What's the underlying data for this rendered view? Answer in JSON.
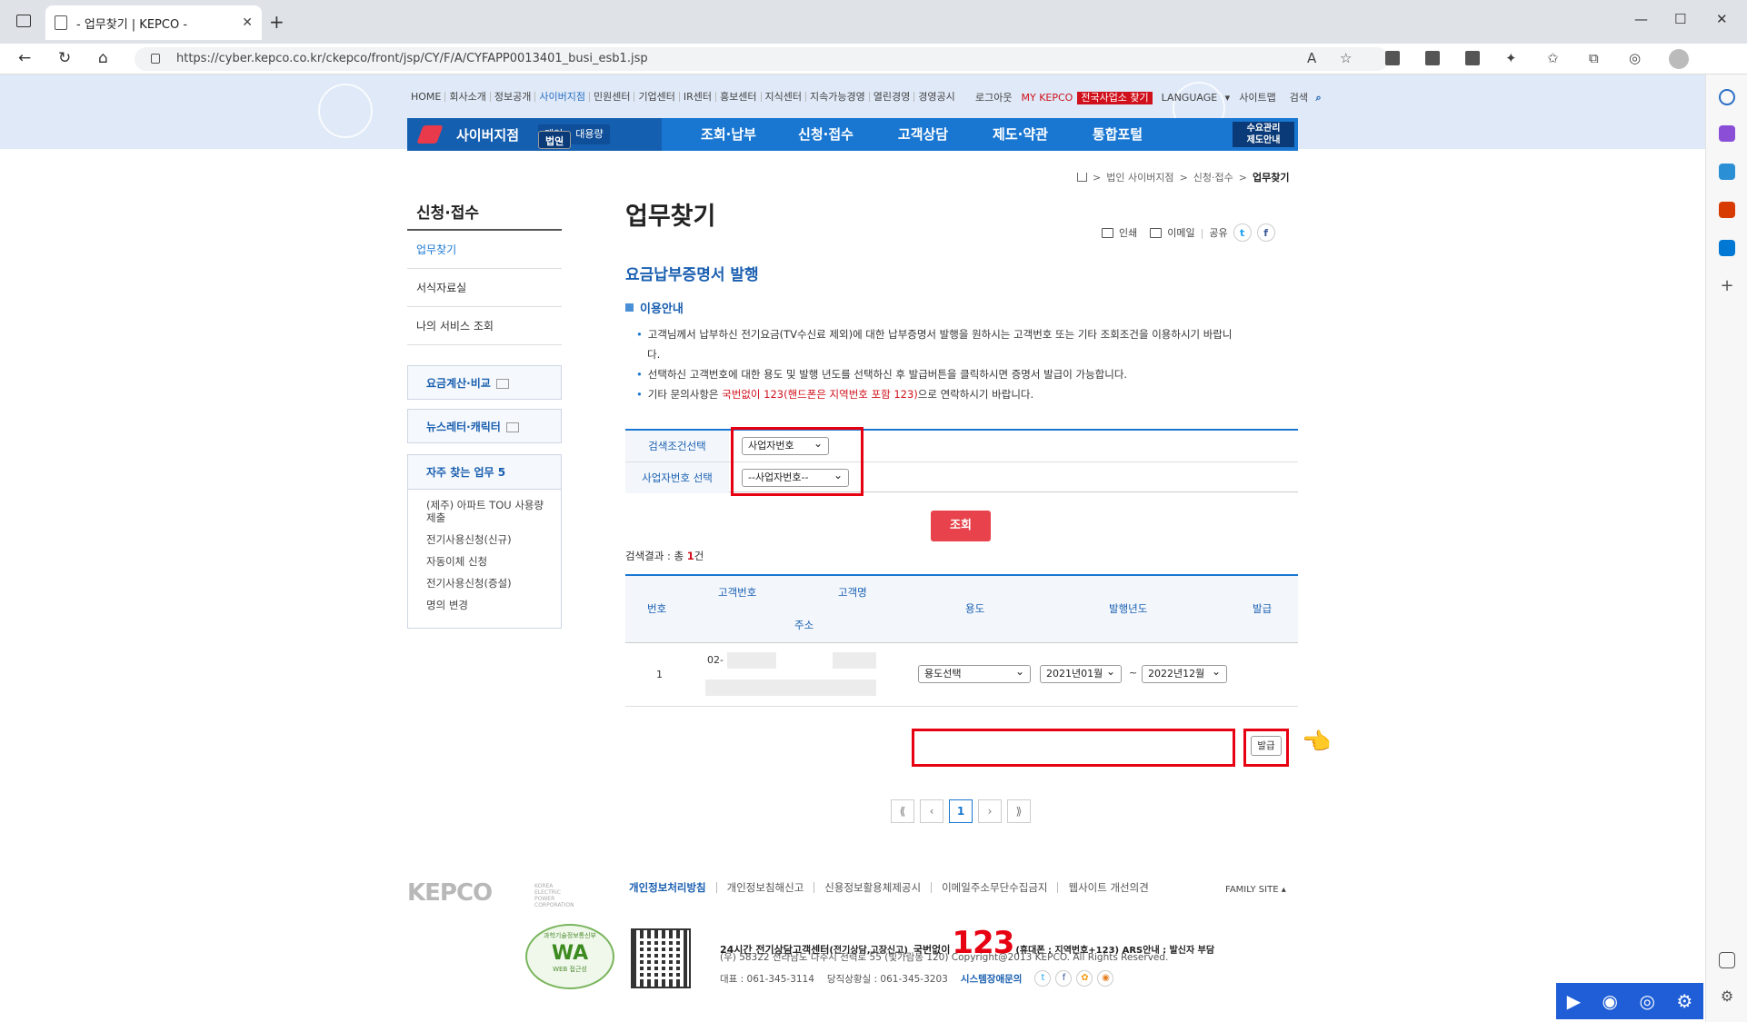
{
  "browser": {
    "tab_title": "- 업무찾기 | KEPCO -",
    "url": "https://cyber.kepco.co.kr/ckepco/front/jsp/CY/F/A/CYFAPP0013401_busi_esb1.jsp"
  },
  "top_nav": [
    "HOME",
    "회사소개",
    "정보공개",
    "사이버지점",
    "민원센터",
    "기업센터",
    "IR센터",
    "홍보센터",
    "지식센터",
    "지속가능경영",
    "열린경영",
    "경영공시"
  ],
  "util_nav": {
    "logout": "로그아웃",
    "my": "MY KEPCO",
    "find_office": "전국사업소 찾기",
    "language": "LANGUAGE",
    "sitemap": "사이트맵",
    "search": "검색"
  },
  "gnb": {
    "brand": "사이버지점",
    "segments": [
      "개인",
      "법인",
      "대용량"
    ],
    "selected_segment": "법인",
    "menu": [
      "조회·납부",
      "신청·접수",
      "고객상담",
      "제도·약관",
      "통합포털"
    ],
    "side_line1": "수요관리",
    "side_line2": "제도안내"
  },
  "breadcrumb": [
    "법인 사이버지점",
    "신청·접수",
    "업무찾기"
  ],
  "lnb": {
    "title": "신청·접수",
    "items": [
      "업무찾기",
      "서식자료실",
      "나의 서비스 조회"
    ],
    "box1": "요금계산·비교",
    "box2": "뉴스레터·캐릭터",
    "faq_title": "자주 찾는 업무 5",
    "faq": [
      "(제주) 아파트 TOU 사용량 제출",
      "전기사용신청(신규)",
      "자동이체 신청",
      "전기사용신청(증설)",
      "명의 변경"
    ]
  },
  "content": {
    "page_title": "업무찾기",
    "share": {
      "print": "인쇄",
      "email": "이메일",
      "share": "공유"
    },
    "section_title": "요금납부증명서 발행",
    "guide_title": "이용안내",
    "bullets": {
      "b1a": "고객님께서 납부하신 전기요금(TV수신료 제외)에 대한 납부증명서 발행을 원하시는 고객번호 또는 기타 조회조건을 이용하시기 바랍니",
      "b1b": "다.",
      "b2": "선택하신 고객번호에 대한 용도 및 발행 년도를 선택하신 후 발급버튼을 클릭하시면 증명서 발급이 가능합니다.",
      "b3_pre": "기타 문의사항은 ",
      "b3_hl": "국번없이 123(핸드폰은 지역번호 포함 123)",
      "b3_post": "으로 연락하시기 바랍니다."
    },
    "search": {
      "label1": "검색조건선택",
      "value1": "사업자번호",
      "label2": "사업자번호 선택",
      "value2": "--사업자번호--"
    },
    "query_button": "조회",
    "result_prefix": "검색결과 : 총 ",
    "result_count": "1",
    "result_suffix": "건",
    "table": {
      "headers": {
        "no": "번호",
        "cust_no": "고객번호",
        "cust_name": "고객명",
        "address": "주소",
        "usage": "용도",
        "year": "발행년도",
        "issue": "발급"
      },
      "rows": [
        {
          "no": "1",
          "cust_no_prefix": "02-",
          "usage": "용도선택",
          "from": "2021년01월",
          "tilde": "~",
          "to": "2022년12월",
          "issue_button": "발급"
        }
      ]
    },
    "pagination": {
      "first": "⟪",
      "prev": "‹",
      "current": "1",
      "next": "›",
      "last": "⟫"
    }
  },
  "footer": {
    "logo": "KEPCO",
    "logo_sub": "KOREA ELECTRIC POWER CORPORATION",
    "links": [
      "개인정보처리방침",
      "개인정보침해신고",
      "신용정보활용체제공시",
      "이메일주소무단수집금지",
      "웹사이트 개선의견"
    ],
    "family_site": "FAMILY SITE",
    "wa_top": "과학기술정보통신부",
    "wa_mark": "WA",
    "wa_bottom": "WEB 접근성",
    "call_pre": "24시간 전기상담고객센터",
    "call_sub": "(전기상담,고장신고)",
    "call_mid": "국번없이",
    "call_num": "123",
    "call_post": "(휴대폰 : 지역번호+123) ARS안내 : 발신자 부담",
    "address": "(우) 58322 전라남도 나주시 전력로 55 (빛가람동 120)      Copyright@2013 KEPCO. All Rights Reserved.",
    "tel1": "대표 : 061-345-3114",
    "tel2": "당직상황실 : 061-345-3203",
    "sys_link": "시스템장애문의"
  },
  "colors": {
    "brand_blue": "#1a77d1",
    "highlight_red": "#e60012",
    "query_button": "#e8434c"
  }
}
